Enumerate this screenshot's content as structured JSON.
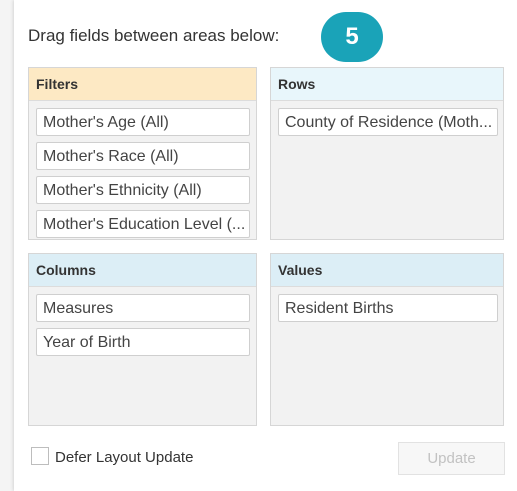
{
  "instruction": "Drag fields between areas below:",
  "step_badge": "5",
  "areas": {
    "filters": {
      "title": "Filters",
      "fields": [
        "Mother's Age (All)",
        "Mother's Race (All)",
        "Mother's Ethnicity (All)",
        "Mother's Education Level (..."
      ]
    },
    "rows": {
      "title": "Rows",
      "fields": [
        "County of Residence (Moth..."
      ]
    },
    "columns": {
      "title": "Columns",
      "fields": [
        "Measures",
        "Year of Birth"
      ]
    },
    "values": {
      "title": "Values",
      "fields": [
        "Resident Births"
      ]
    }
  },
  "defer_label": "Defer Layout Update",
  "update_label": "Update",
  "colors": {
    "badge": "#1aa3b8",
    "filters_header": "#fde9c4",
    "rows_header": "#e8f6fb",
    "columns_values_header": "#dceef6"
  }
}
